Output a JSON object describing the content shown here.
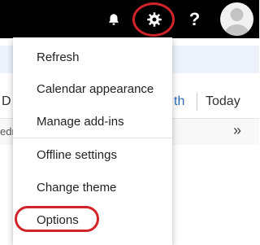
{
  "header": {
    "notifications_icon": "bell-icon",
    "settings_icon": "gear-icon",
    "help_label": "?",
    "avatar_icon": "person-icon"
  },
  "background": {
    "partial_left": "D",
    "view_partial": "th",
    "today_label": "Today",
    "row_partial": "edr",
    "expand_label": "»"
  },
  "settings_menu": {
    "items": [
      {
        "label": "Refresh"
      },
      {
        "label": "Calendar appearance"
      },
      {
        "label": "Manage add-ins"
      },
      {
        "label": "Offline settings"
      },
      {
        "label": "Change theme"
      },
      {
        "label": "Options"
      }
    ]
  },
  "colors": {
    "topbar": "#000000",
    "highlight": "#d2232a",
    "link": "#2b6bbf"
  }
}
